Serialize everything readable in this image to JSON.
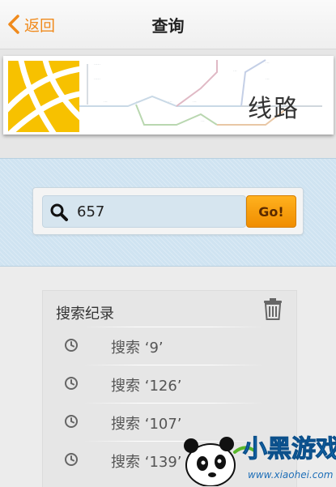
{
  "nav": {
    "back_label": "返回",
    "title": "查询"
  },
  "banner": {
    "title": "线路"
  },
  "search": {
    "value": "657",
    "go_label": "Go!"
  },
  "history": {
    "title": "搜索纪录",
    "items": [
      {
        "label": "搜索 ‘9’"
      },
      {
        "label": "搜索 ‘126’"
      },
      {
        "label": "搜索 ‘107’"
      },
      {
        "label": "搜索 ‘139’"
      }
    ]
  },
  "watermark": {
    "text": "小黑游戏",
    "url": "www.xiaohei.com"
  },
  "colors": {
    "accent": "#f08a1c",
    "go_button": "#f5a000",
    "search_bg": "#cfe3f1",
    "logo_yellow": "#f7c100"
  }
}
